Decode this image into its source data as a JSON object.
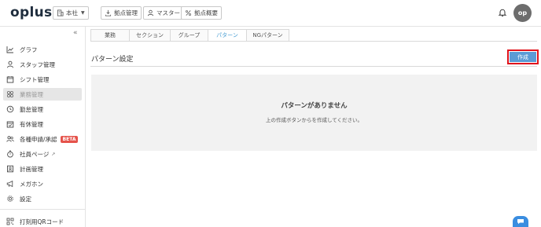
{
  "header": {
    "logo": "oplus",
    "office_select": "本社",
    "buttons": {
      "location_admin": "拠点管理",
      "master": "マスター",
      "location_overview": "拠点概要"
    },
    "avatar_initials": "op"
  },
  "sidebar": {
    "items": [
      {
        "label": "グラフ",
        "icon": "chart-line-icon"
      },
      {
        "label": "スタッフ管理",
        "icon": "person-icon"
      },
      {
        "label": "シフト管理",
        "icon": "calendar-icon"
      },
      {
        "label": "業務管理",
        "icon": "tasks-icon",
        "active": true
      },
      {
        "label": "勤怠管理",
        "icon": "clock-icon"
      },
      {
        "label": "有休管理",
        "icon": "calendar-check-icon"
      },
      {
        "label": "各種申請/承認",
        "icon": "users-icon",
        "badge": "BETA"
      },
      {
        "label": "社員ページ",
        "icon": "stopwatch-icon",
        "external": true
      },
      {
        "label": "計画管理",
        "icon": "plan-icon"
      },
      {
        "label": "メガホン",
        "icon": "megaphone-icon"
      },
      {
        "label": "設定",
        "icon": "gear-icon"
      },
      {
        "label": "打刻用QRコード",
        "icon": "qr-code-icon"
      }
    ]
  },
  "tabs": [
    {
      "label": "業務"
    },
    {
      "label": "セクション"
    },
    {
      "label": "グループ"
    },
    {
      "label": "パターン",
      "active": true
    },
    {
      "label": "NGパターン"
    }
  ],
  "main": {
    "title": "パターン設定",
    "create_label": "作成",
    "empty_title": "パターンがありません",
    "empty_subtitle": "上の作成ボタンからを作成してください。"
  },
  "colors": {
    "accent": "#5b9bd5",
    "active_tab": "#4a9fd4",
    "beta_badge": "#e5534b",
    "highlight_border": "#e0131c",
    "avatar": "#6d6d6d"
  }
}
